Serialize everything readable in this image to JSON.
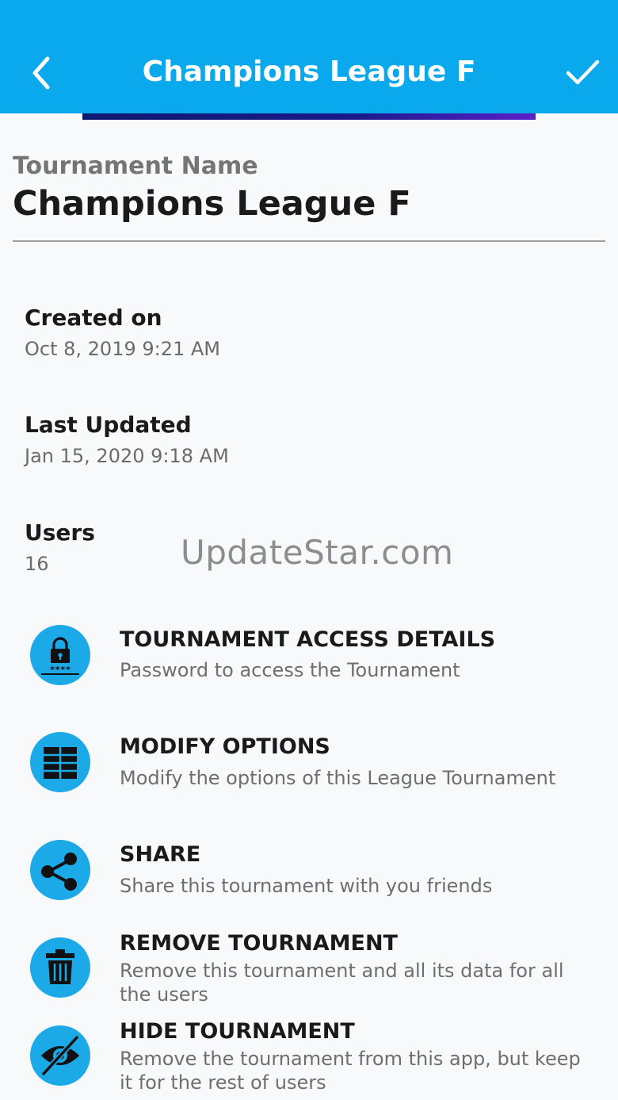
{
  "appbar": {
    "title": "Champions League F",
    "icons": {
      "back": "back-chevron-icon",
      "confirm": "checkmark-icon"
    },
    "color": "#0aa8ec"
  },
  "tournament": {
    "name_label": "Tournament Name",
    "name_value": "Champions League F"
  },
  "info": {
    "created_label": "Created on",
    "created_value": "Oct 8, 2019 9:21 AM",
    "updated_label": "Last Updated",
    "updated_value": "Jan 15, 2020 9:18 AM",
    "users_label": "Users",
    "users_value": "16"
  },
  "watermark": "UpdateStar.com",
  "actions": [
    {
      "title": "TOURNAMENT ACCESS DETAILS",
      "subtitle": "Password to access the Tournament",
      "icon": "lock-password-icon"
    },
    {
      "title": "MODIFY OPTIONS",
      "subtitle": "Modify the options of this League Tournament",
      "icon": "table-grid-icon"
    },
    {
      "title": "SHARE",
      "subtitle": "Share this tournament with you friends",
      "icon": "share-icon"
    },
    {
      "title": "REMOVE TOURNAMENT",
      "subtitle": "Remove this tournament and all its data for all the users",
      "icon": "trash-icon"
    },
    {
      "title": "HIDE TOURNAMENT",
      "subtitle": "Remove the tournament from this app, but keep it for the rest of users",
      "icon": "eye-off-icon"
    }
  ],
  "colors": {
    "accent": "#1ba9e8",
    "progress_start": "#0d1a6e",
    "progress_end": "#5a20c8"
  }
}
